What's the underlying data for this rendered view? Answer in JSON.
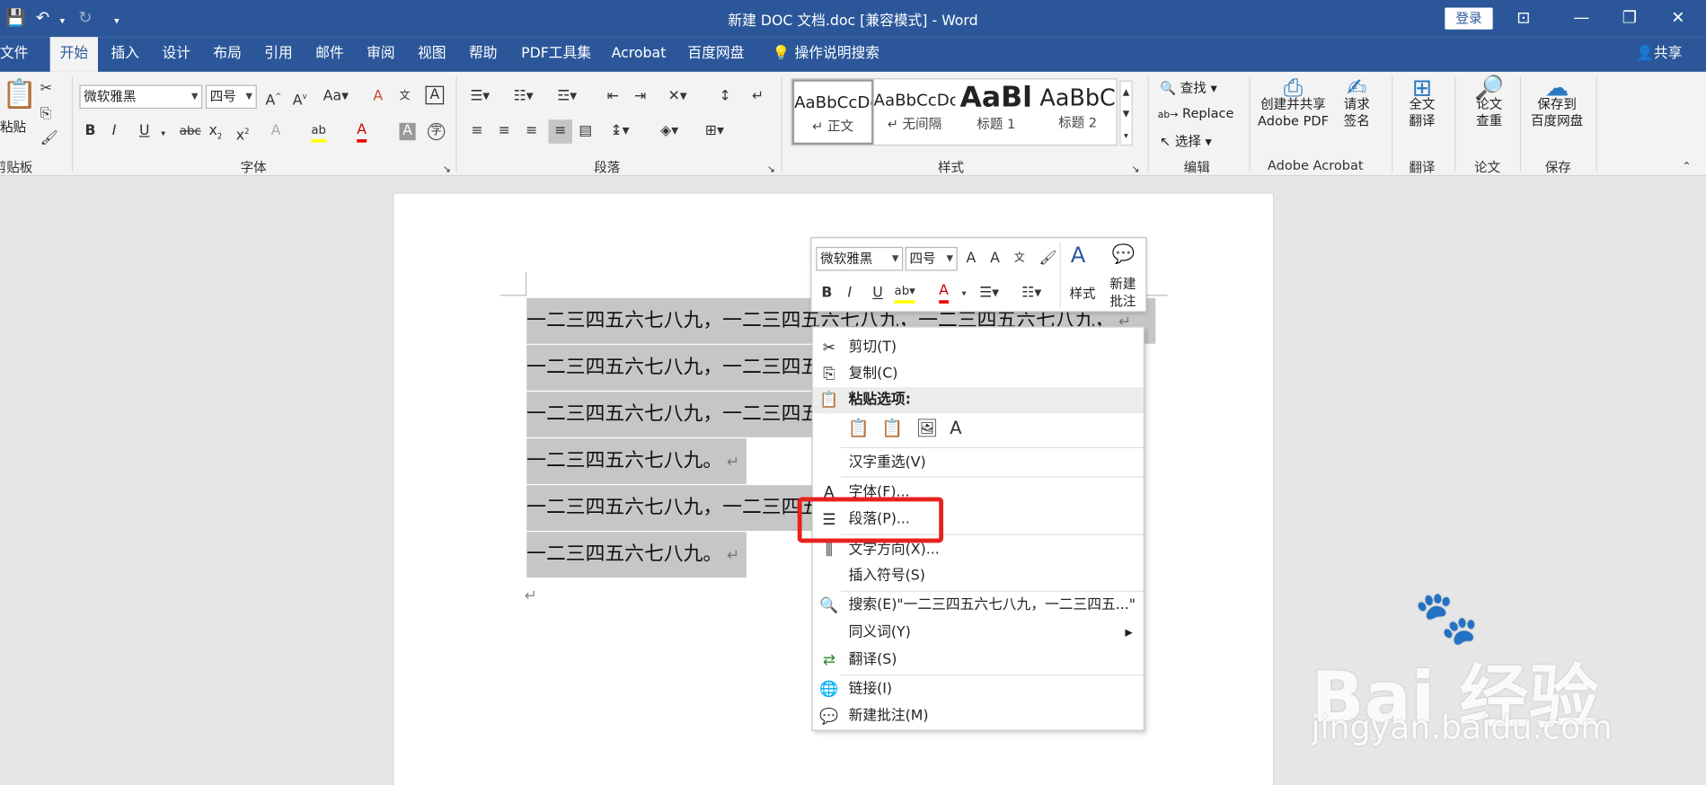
{
  "window": {
    "title": "新建 DOC 文档.doc [兼容模式] - Word",
    "login_label": "登录"
  },
  "tabs": [
    {
      "label": "文件",
      "active": false
    },
    {
      "label": "开始",
      "active": true
    },
    {
      "label": "插入",
      "active": false
    },
    {
      "label": "设计",
      "active": false
    },
    {
      "label": "布局",
      "active": false
    },
    {
      "label": "引用",
      "active": false
    },
    {
      "label": "邮件",
      "active": false
    },
    {
      "label": "审阅",
      "active": false
    },
    {
      "label": "视图",
      "active": false
    },
    {
      "label": "帮助",
      "active": false
    },
    {
      "label": "PDF工具集",
      "active": false
    },
    {
      "label": "Acrobat",
      "active": false
    },
    {
      "label": "百度网盘",
      "active": false
    }
  ],
  "tell_me": "操作说明搜索",
  "share_label": "共享",
  "ribbon": {
    "clipboard": {
      "paste": "粘贴",
      "group": "剪贴板"
    },
    "font": {
      "name": "微软雅黑",
      "size": "四号",
      "group": "字体"
    },
    "paragraph": {
      "group": "段落"
    },
    "styles": {
      "group": "样式",
      "items": [
        {
          "preview": "AaBbCcDc",
          "name": "↵ 正文"
        },
        {
          "preview": "AaBbCcDc",
          "name": "↵ 无间隔"
        },
        {
          "preview": "AaBl",
          "name": "标题 1"
        },
        {
          "preview": "AaBbC",
          "name": "标题 2"
        }
      ]
    },
    "editing": {
      "find": "查找",
      "replace": "Replace",
      "select": "选择",
      "group": "编辑"
    },
    "acrobat": {
      "create": "创建并共享",
      "create2": "Adobe PDF",
      "sign": "请求",
      "sign2": "签名",
      "group": "Adobe Acrobat"
    },
    "translate": {
      "b1": "全文",
      "b2": "翻译",
      "group": "翻译"
    },
    "paper": {
      "b1": "论文",
      "b2": "查重",
      "group": "论文"
    },
    "save": {
      "b1": "保存到",
      "b2": "百度网盘",
      "group": "保存"
    }
  },
  "document": {
    "lines": [
      "一二三四五六七八九，一二三四五六七八九，一二三四五六七八九，",
      "一二三四五六七八九，一二三四五六七八九，一二三四五六七八九，",
      "一二三四五六七八九，一二三四五六七八九，一二三四五六七八九，",
      "一二三四五六七八九。",
      "一二三四五六七八九，一二三四五六七八九，一二三四五六七八九，",
      "一二三四五六七八九。"
    ],
    "paragraph_mark": "↵"
  },
  "mini_toolbar": {
    "font": "微软雅黑",
    "size": "四号",
    "styles_label": "样式",
    "new_comment1": "新建",
    "new_comment2": "批注"
  },
  "context_menu": {
    "cut": "剪切(T)",
    "copy": "复制(C)",
    "paste_options": "粘贴选项:",
    "reconvert": "汉字重选(V)",
    "font": "字体(F)...",
    "paragraph": "段落(P)...",
    "text_direction": "文字方向(X)...",
    "insert_symbol": "插入符号(S)",
    "search": "搜索(E)\"一二三四五六七八九，一二三四五...\"",
    "synonyms": "同义词(Y)",
    "translate": "翻译(S)",
    "link": "链接(I)",
    "new_comment": "新建批注(M)"
  },
  "watermark": {
    "brand": "Bai  经验",
    "url": "jingyan.baidu.com"
  },
  "colors": {
    "titlebar": "#2b579a",
    "highlight": "#e8201e",
    "selection": "#c6c6c6"
  }
}
